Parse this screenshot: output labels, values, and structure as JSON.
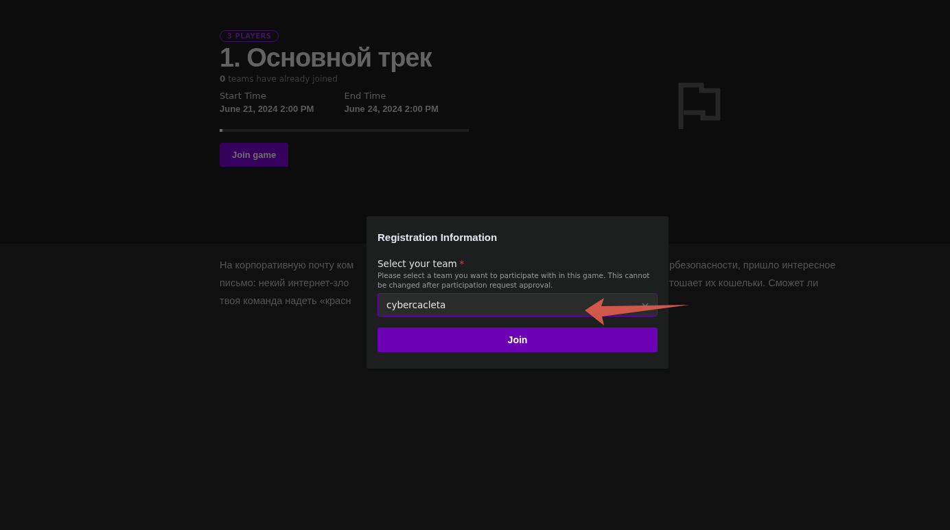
{
  "game": {
    "badge": "3 PLAYERS",
    "title": "1. Основной трек",
    "joined_count": "0",
    "joined_text": "teams have already joined",
    "start_label": "Start Time",
    "start_value": "June 21, 2024 2:00 PM",
    "end_label": "End Time",
    "end_value": "June 24, 2024 2:00 PM",
    "progress": {
      "level": 0.01
    },
    "join_button": "Join game"
  },
  "description_lines": [
    {
      "left": "На корпоративную почту ком",
      "right": "рбезопасности, пришло интересное"
    },
    {
      "left": "письмо: некий интернет-зло",
      "right": "тошает их кошельки. Сможет ли"
    },
    {
      "left": "твоя команда надеть «красн"
    }
  ],
  "modal": {
    "title": "Registration Information",
    "field_label": "Select your team",
    "required_mark": "*",
    "help_text": "Please select a team you want to participate with in this game. This cannot be changed after participation request approval.",
    "team_value": "cybercacleta",
    "submit_button": "Join"
  }
}
